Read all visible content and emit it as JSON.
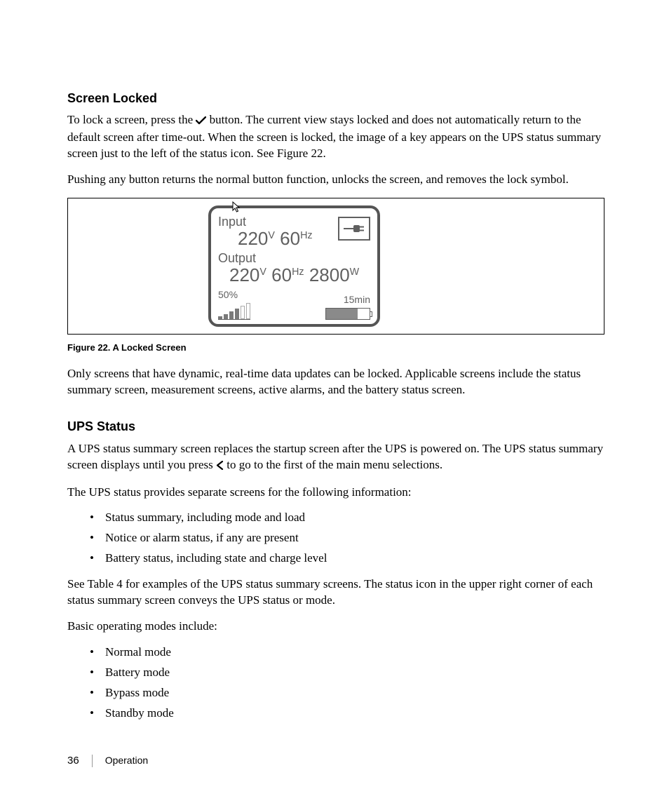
{
  "section1": {
    "heading": "Screen Locked",
    "para1a": "To lock a screen, press the ",
    "para1b": " button. The current view stays locked and does not automatically return to the default screen after time-out. When the screen is locked, the image of a key appears on the UPS status summary screen just to the left of the status icon. See Figure 22.",
    "para2": "Pushing any button returns the normal button function, unlocks the screen, and removes the lock symbol."
  },
  "figure": {
    "caption": "Figure 22. A Locked Screen",
    "display": {
      "input_label": "Input",
      "input_voltage": "220",
      "input_v_unit": "V",
      "input_freq": "60",
      "input_hz_unit": "Hz",
      "output_label": "Output",
      "output_voltage": "220",
      "output_v_unit": "V",
      "output_freq": "60",
      "output_hz_unit": "Hz",
      "output_power": "2800",
      "output_w_unit": "W",
      "load_pct": "50%",
      "runtime": "15min",
      "battery_fill_pct": 72
    }
  },
  "para3": "Only screens that have dynamic, real-time data updates can be locked. Applicable screens include the status summary screen, measurement screens, active alarms, and the battery status screen.",
  "section2": {
    "heading": "UPS Status",
    "para1a": "A UPS status summary screen replaces the startup screen after the UPS is powered on. The UPS status summary screen displays until you press ",
    "para1b": " to go to the first of the main menu selections.",
    "para2": "The UPS status provides separate screens for the following information:",
    "bullets1": [
      "Status summary, including mode and load",
      "Notice or alarm status, if any are present",
      "Battery status, including state and charge level"
    ],
    "para3": "See Table 4 for examples of the UPS status summary screens. The status icon in the upper right corner of each status summary screen conveys the UPS status or mode.",
    "para4": "Basic operating modes include:",
    "bullets2": [
      "Normal mode",
      "Battery mode",
      "Bypass mode",
      "Standby mode"
    ]
  },
  "footer": {
    "page": "36",
    "chapter": "Operation"
  }
}
